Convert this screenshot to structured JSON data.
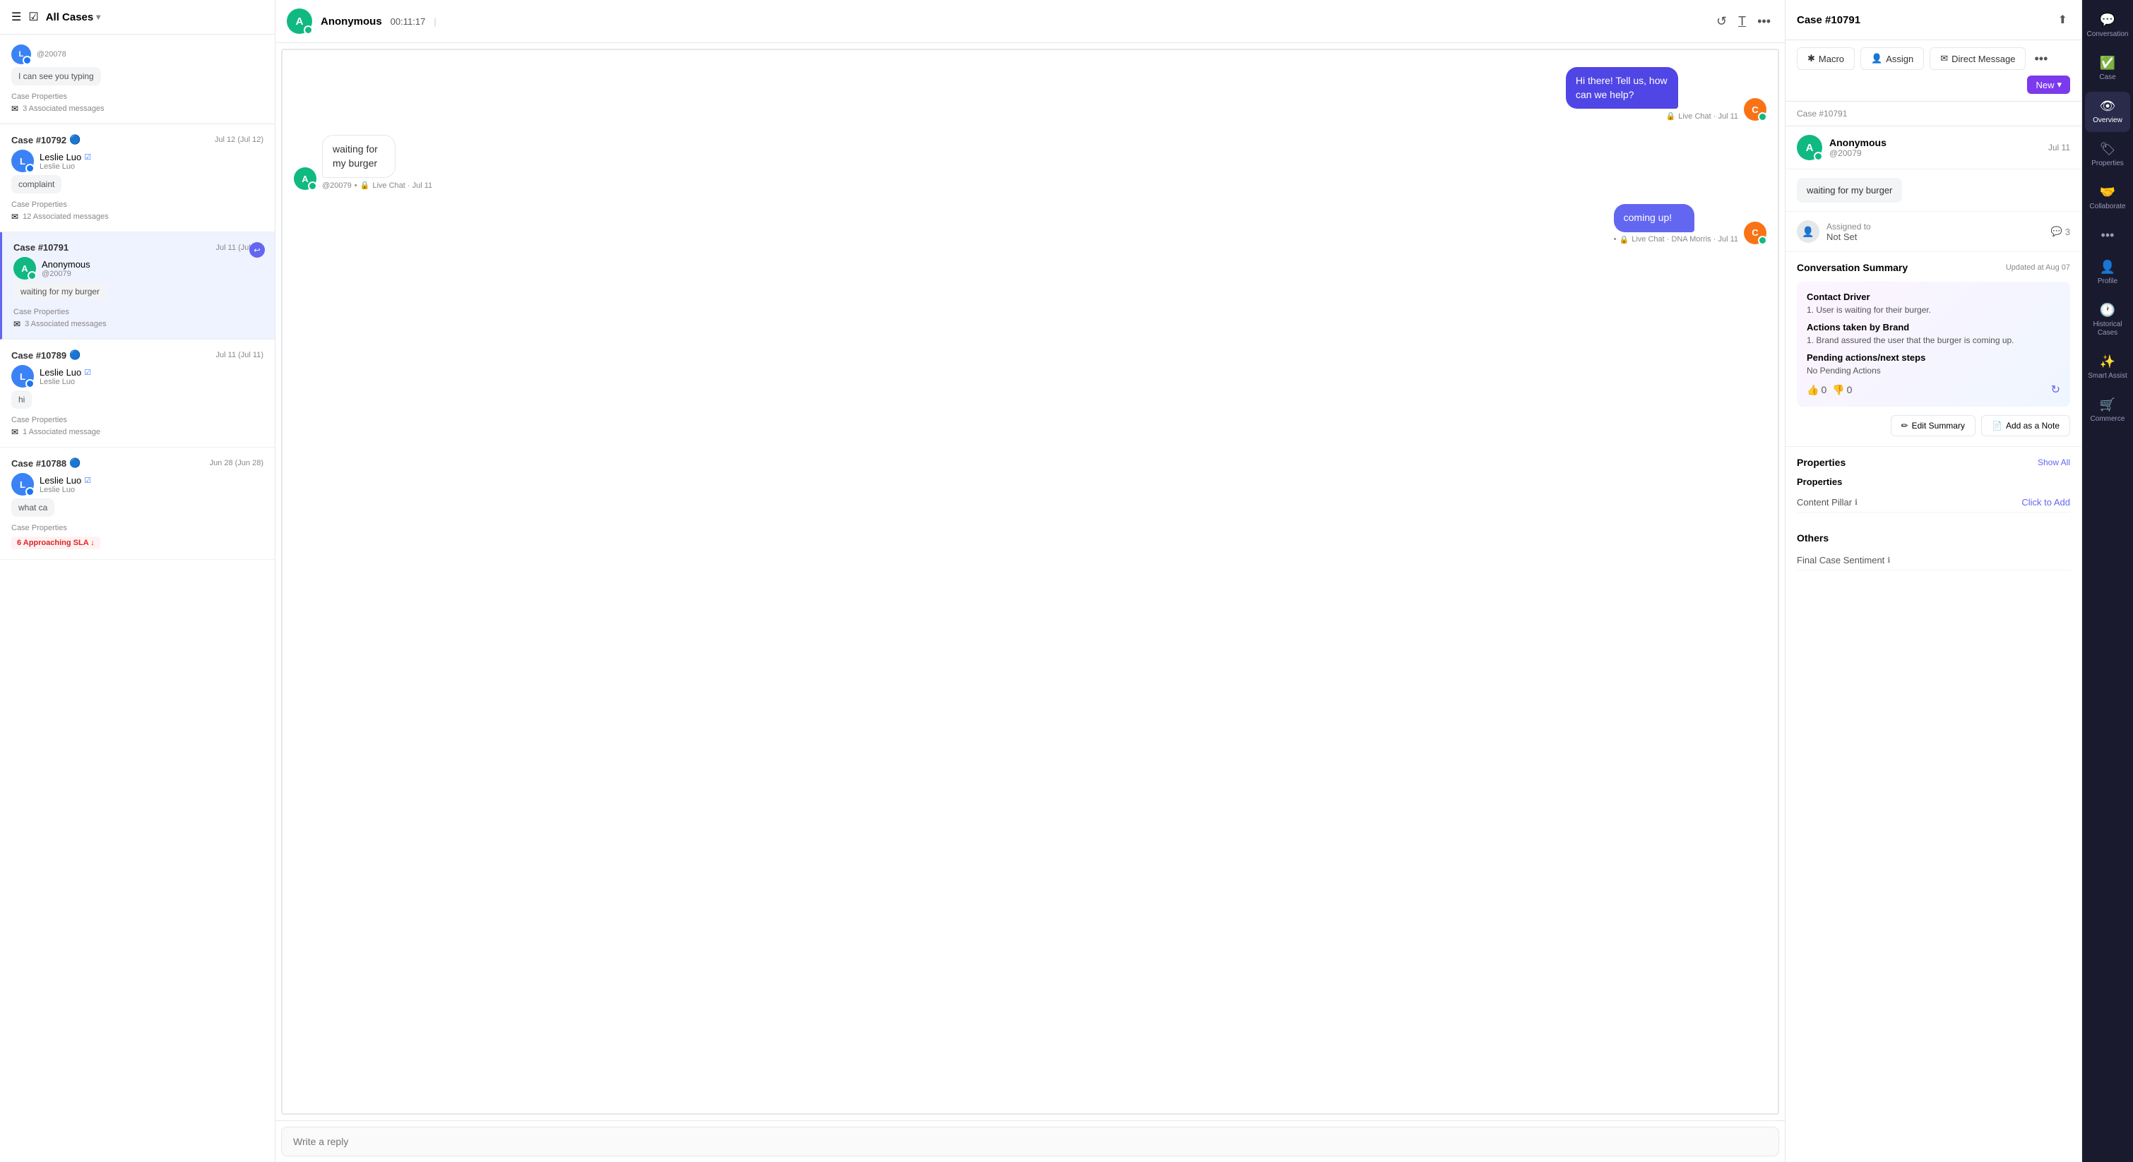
{
  "nav": {
    "items": [
      {
        "id": "conversation",
        "label": "Conversation",
        "icon": "💬",
        "active": false
      },
      {
        "id": "case",
        "label": "Case",
        "icon": "✅",
        "active": false
      },
      {
        "id": "overview",
        "label": "Overview",
        "icon": "👁",
        "active": false
      },
      {
        "id": "properties",
        "label": "Properties",
        "icon": "🏷",
        "active": false
      },
      {
        "id": "collaborate",
        "label": "Collaborate",
        "icon": "🤝",
        "active": false
      },
      {
        "id": "more",
        "label": "...",
        "icon": "•••",
        "active": false
      },
      {
        "id": "profile",
        "label": "Profile",
        "icon": "👤",
        "active": false
      },
      {
        "id": "historical-cases",
        "label": "Historical Cases",
        "icon": "🕐",
        "active": false
      },
      {
        "id": "smart-assist",
        "label": "Smart Assist",
        "icon": "✨",
        "active": false
      },
      {
        "id": "commerce",
        "label": "Commerce",
        "icon": "🛒",
        "active": false
      }
    ]
  },
  "cases_panel": {
    "header": {
      "menu_icon": "☰",
      "checkbox_icon": "☑",
      "title": "All Cases",
      "chevron_icon": "▾"
    },
    "cases": [
      {
        "id": "Case #10792",
        "badge_icon": "🔵",
        "date": "Jul 12 (Jul 12)",
        "avatar_letter": "L",
        "avatar_color": "blue",
        "avatar_badge": "🔵",
        "username": "Leslie Luo",
        "verified_icon": "☑",
        "handle": "Leslie Luo",
        "message": "complaint",
        "props_label": "Case Properties",
        "associated_count": "12 Associated messages",
        "selected": false
      },
      {
        "id": "Case #10791",
        "badge_icon": "↩",
        "date": "Jul 11 (Jul 11)",
        "avatar_letter": "A",
        "avatar_color": "green",
        "avatar_badge": "🟢",
        "username": "Anonymous",
        "handle": "@20079",
        "message": "waiting for my burger",
        "props_label": "Case Properties",
        "associated_count": "3 Associated messages",
        "selected": true
      },
      {
        "id": "Case #10789",
        "badge_icon": "",
        "date": "Jul 11 (Jul 11)",
        "avatar_letter": "L",
        "avatar_color": "blue",
        "avatar_badge": "🔵",
        "username": "Leslie Luo",
        "verified_icon": "☑",
        "handle": "Leslie Luo",
        "message": "hi",
        "props_label": "Case Properties",
        "associated_count": "1 Associated message",
        "selected": false
      },
      {
        "id": "Case #10788",
        "badge_icon": "",
        "date": "Jun 28 (Jun 28)",
        "avatar_letter": "L",
        "avatar_color": "blue",
        "avatar_badge": "🔵",
        "username": "Leslie Luo",
        "verified_icon": "☑",
        "handle": "Leslie Luo",
        "message": "what ca",
        "props_label": "Case Properties",
        "associated_count": "",
        "selected": false,
        "sla_badge": "6 Approaching SLA ↓"
      }
    ]
  },
  "cases_top": {
    "at_handle": "@20078",
    "message": "I can see you typing",
    "props_label": "Case Properties",
    "associated_count": "3 Associated messages"
  },
  "chat": {
    "header": {
      "avatar_letter": "A",
      "avatar_color": "green",
      "name": "Anonymous",
      "timer": "00:11:17",
      "divider": "|",
      "refresh_icon": "↺",
      "translate_icon": "T̲",
      "more_icon": "•••"
    },
    "messages": [
      {
        "id": "msg1",
        "side": "right",
        "text": "Hi there! Tell us, how can we help?",
        "meta": "• 🔒 Live Chat • Jul 11",
        "avatar_letter": "C",
        "avatar_color": "orange"
      },
      {
        "id": "msg2",
        "side": "left",
        "text": "waiting for my burger",
        "meta": "@20079 • 🔒 Live Chat • Jul 11",
        "avatar_letter": "A",
        "avatar_color": "green"
      },
      {
        "id": "msg3",
        "side": "right",
        "text": "coming up!",
        "meta": "• 🔒 Live Chat • DNA Morris • Jul 11",
        "avatar_letter": "C",
        "avatar_color": "orange"
      }
    ],
    "footer": {
      "placeholder": "Write a reply"
    }
  },
  "info": {
    "header": {
      "case_id": "Case #10791",
      "share_icon": "⬆",
      "new_label": "New",
      "chevron_icon": "▾"
    },
    "toolbar": {
      "macro_icon": "✱",
      "macro_label": "Macro",
      "assign_icon": "👤",
      "assign_label": "Assign",
      "direct_message_icon": "✉",
      "direct_message_label": "Direct Message",
      "more_icon": "•••"
    },
    "contact": {
      "avatar_letter": "A",
      "avatar_color": "green",
      "name": "Anonymous",
      "handle": "@20079",
      "date": "Jul 11"
    },
    "message": "waiting for my burger",
    "assigned": {
      "label": "Assigned to",
      "value": "Not Set",
      "comment_count": "3"
    },
    "summary": {
      "title": "Conversation Summary",
      "updated": "Updated at Aug 07",
      "contact_driver_title": "Contact Driver",
      "contact_driver_text": "1. User is waiting for their burger.",
      "actions_title": "Actions taken by Brand",
      "actions_text": "1. Brand assured the user that the burger is coming up.",
      "pending_title": "Pending actions/next steps",
      "pending_text": "No Pending Actions",
      "thumbs_up_count": "0",
      "thumbs_down_count": "0",
      "edit_label": "Edit Summary",
      "note_label": "Add as a Note"
    },
    "properties": {
      "title": "Properties",
      "show_all_label": "Show All",
      "sub_title": "Properties",
      "content_pillar_label": "Content Pillar",
      "info_icon": "ℹ",
      "content_pillar_value": "Click to Add"
    },
    "others": {
      "title": "Others",
      "final_sentiment_label": "Final Case Sentiment",
      "info_icon": "ℹ"
    }
  }
}
